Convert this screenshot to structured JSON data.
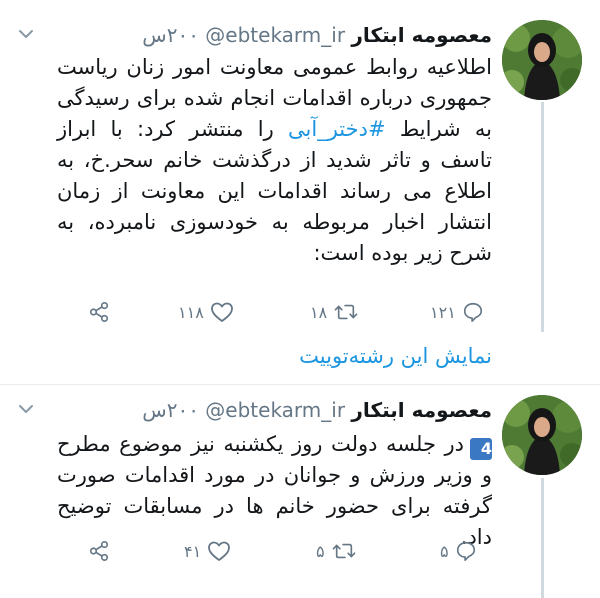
{
  "colors": {
    "link": "#1b95e0",
    "muted": "#657786",
    "thread_line": "#cfd9de",
    "badge": "#3b78c4"
  },
  "tweets": [
    {
      "name": "معصومه ابتکار",
      "handle": "@ebtekarm_ir",
      "time": "۲۰۰س",
      "text_before": "اطلاعیه روابط عمومی معاونت امور زنان ریاست جمهوری درباره اقدامات انجام شده برای رسیدگی به شرایط ",
      "hashtag": "#دختر_آبی",
      "text_after": " را منتشر کرد: با ابراز تاسف و تاثر شدید از درگذشت خانم سحر.خ، به اطلاع می رساند اقدامات این معاونت از زمان انتشار اخبار مربوطه به خودسوزی نامبرده، به شرح زیر بوده است:",
      "replies": "۱۲۱",
      "retweets": "۱۸",
      "likes": "۱۱۸",
      "icons": [
        "reply-icon",
        "retweet-icon",
        "like-icon",
        "share-icon"
      ]
    },
    {
      "name": "معصومه ابتکار",
      "handle": "@ebtekarm_ir",
      "time": "۲۰۰س",
      "badge": "4",
      "text": "در جلسه دولت روز یکشنبه نیز موضوع مطرح و وزیر ورزش و جوانان در مورد اقدامات صورت گرفته برای حضور خانم ها در مسابقات توضیح داد.",
      "replies": "۵",
      "retweets": "۵",
      "likes": "۴۱",
      "icons": [
        "reply-icon",
        "retweet-icon",
        "like-icon",
        "share-icon"
      ]
    }
  ],
  "show_thread_label": "نمایش این رشته‌توییت"
}
